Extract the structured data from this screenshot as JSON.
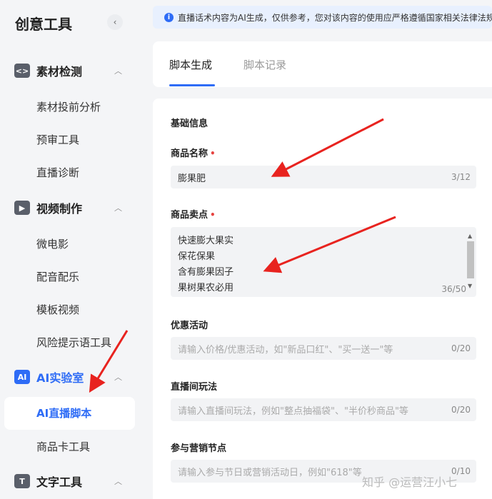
{
  "sidebar": {
    "brand": "创意工具",
    "collapse_icon": "chevron-left-icon",
    "groups": [
      {
        "label": "素材检测",
        "icon": "code-brackets-icon",
        "icon_glyph": "<>"
      },
      {
        "label": "视频制作",
        "icon": "play-icon",
        "icon_glyph": "▶"
      },
      {
        "label": "AI实验室",
        "icon": "ai-icon",
        "icon_glyph": "AI"
      },
      {
        "label": "文字工具",
        "icon": "text-icon",
        "icon_glyph": "T"
      }
    ],
    "items": {
      "material_analysis": "素材投前分析",
      "precheck": "预审工具",
      "live_diagnosis": "直播诊断",
      "micro_film": "微电影",
      "dubbing": "配音配乐",
      "template_video": "模板视频",
      "risk_tips": "风险提示语工具",
      "ai_live_script": "AI直播脚本",
      "product_card": "商品卡工具"
    },
    "accent_color": "#2e6cf6"
  },
  "notice": {
    "text": "直播话术内容为AI生成，仅供参考，您对该内容的使用应严格遵循国家相关法律法规"
  },
  "tabs": [
    {
      "label": "脚本生成",
      "active": true
    },
    {
      "label": "脚本记录",
      "active": false
    }
  ],
  "form": {
    "section_title": "基础信息",
    "product_name": {
      "label": "商品名称",
      "required_mark": "•",
      "value": "膨果肥",
      "count": "3/12"
    },
    "selling_points": {
      "label": "商品卖点",
      "required_mark": "•",
      "lines": [
        "快速膨大果实",
        "保花保果",
        "含有膨果因子",
        "果树果农必用"
      ],
      "count": "36/50"
    },
    "promotion": {
      "label": "优惠活动",
      "placeholder": "请输入价格/优惠活动，如\"新品口红\"、\"买一送一\"等",
      "count": "0/20"
    },
    "live_play": {
      "label": "直播间玩法",
      "placeholder": "请输入直播间玩法，例如\"整点抽福袋\"、\"半价秒商品\"等",
      "count": "0/20"
    },
    "marketing_node": {
      "label": "参与营销节点",
      "placeholder": "请输入参与节日或营销活动日，例如\"618\"等",
      "count": "0/10"
    }
  },
  "watermark": "知乎 @运营汪小七"
}
